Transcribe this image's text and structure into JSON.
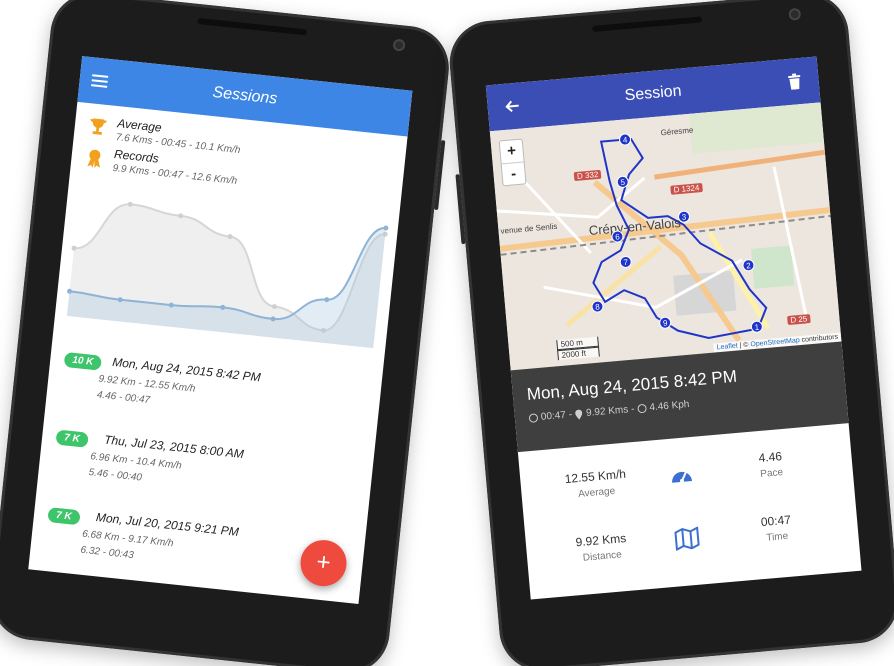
{
  "sessions_screen": {
    "title": "Sessions",
    "average": {
      "label": "Average",
      "value": "7.6 Kms - 00:45 - 10.1 Km/h"
    },
    "records": {
      "label": "Records",
      "value": "9.9 Kms - 00:47 - 12.6 Km/h"
    },
    "sessions": [
      {
        "badge": "10 K",
        "date": "Mon, Aug 24, 2015 8:42 PM",
        "line1": "9.92 Km - 12.55 Km/h",
        "line2": "4.46 - 00:47"
      },
      {
        "badge": "7 K",
        "date": "Thu, Jul 23, 2015 8:00 AM",
        "line1": "6.96 Km - 10.4 Km/h",
        "line2": "5.46 - 00:40"
      },
      {
        "badge": "7 K",
        "date": "Mon, Jul 20, 2015 9:21 PM",
        "line1": "6.68 Km - 9.17 Km/h",
        "line2": "6.32 - 00:43"
      }
    ],
    "fab_label": "+",
    "colors": {
      "appbar": "#3d86e6",
      "badge": "#3ec46a",
      "fab": "#ee4a3e",
      "trophy": "#f2a11f"
    }
  },
  "session_screen": {
    "title": "Session",
    "map": {
      "zoom_in": "+",
      "zoom_out": "-",
      "labels": [
        "Géresme",
        "Crépy-en-Valois",
        "D 1324",
        "D 332",
        "D 25",
        "venue de Senlis"
      ],
      "scale_m": "500 m",
      "scale_ft": "2000 ft",
      "attribution_leaflet": "Leaflet",
      "attribution_sep": " | © ",
      "attribution_osm": "OpenStreetMap",
      "attribution_tail": " contributors",
      "markers": [
        "1",
        "2",
        "3",
        "4",
        "5",
        "6",
        "7",
        "8",
        "9"
      ]
    },
    "hero": {
      "date": "Mon, Aug 24, 2015 8:42 PM",
      "duration": "00:47",
      "sep1": "-",
      "distance": "9.92 Kms",
      "sep2": "-",
      "speed": "4.46 Kph"
    },
    "metrics": {
      "speed_value": "12.55 Km/h",
      "speed_label": "Average",
      "pace_value": "4.46",
      "pace_label": "Pace",
      "distance_value": "9.92 Kms",
      "distance_label": "Distance",
      "time_value": "00:47",
      "time_label": "Time"
    },
    "colors": {
      "appbar": "#3b4eb5",
      "hero": "#3f3f3f",
      "route": "#1f35c9"
    }
  },
  "chart_data": {
    "type": "line",
    "x": [
      1,
      2,
      3,
      4,
      5,
      6,
      7
    ],
    "series": [
      {
        "values": [
          8.2,
          9.8,
          9.6,
          9.1,
          7.0,
          6.4,
          9.7
        ]
      },
      {
        "values": [
          6.8,
          6.7,
          6.7,
          6.8,
          6.6,
          7.4,
          9.9
        ]
      }
    ],
    "grid": false
  }
}
